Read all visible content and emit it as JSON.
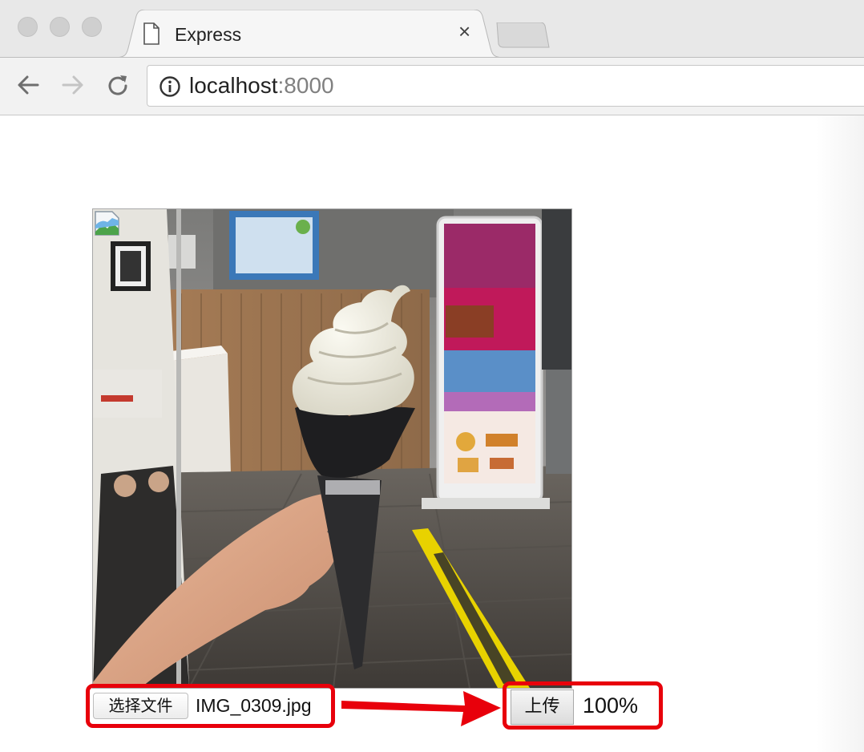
{
  "browser": {
    "tab_title": "Express",
    "tab_close": "×",
    "url_host": "localhost",
    "url_port": ":8000"
  },
  "page": {
    "image_alt": "",
    "file_button_label": "选择文件",
    "file_name": "IMG_0309.jpg",
    "upload_button_label": "上传",
    "progress_text": "100%",
    "progress_value": 1.0
  },
  "annotation": {
    "color": "#e8000b"
  },
  "icons": {
    "tab": "document-icon",
    "back": "back-arrow-icon",
    "forward": "forward-arrow-icon",
    "reload": "reload-icon",
    "site_info": "info-icon",
    "broken_image": "broken-image-icon"
  }
}
